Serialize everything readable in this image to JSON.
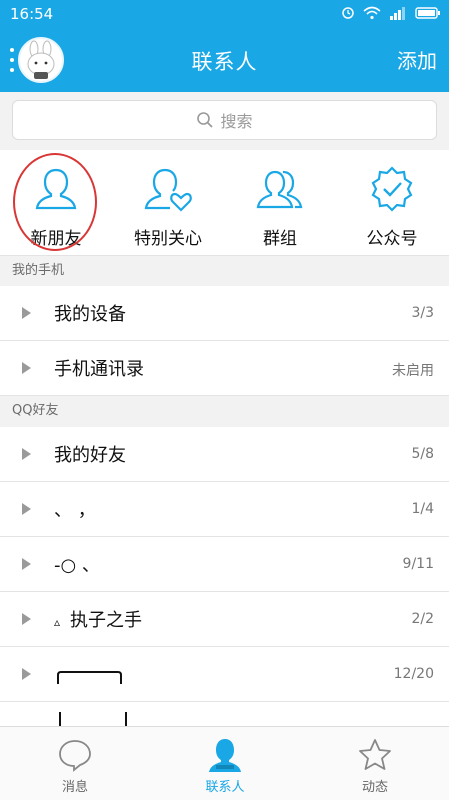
{
  "status_bar": {
    "time": "16:54"
  },
  "header": {
    "title": "联系人",
    "add_label": "添加"
  },
  "search": {
    "placeholder": "搜索"
  },
  "quick_actions": [
    {
      "label": "新朋友",
      "icon": "person-icon"
    },
    {
      "label": "特别关心",
      "icon": "person-heart-icon"
    },
    {
      "label": "群组",
      "icon": "group-icon"
    },
    {
      "label": "公众号",
      "icon": "verified-badge-icon"
    }
  ],
  "sections": {
    "my_phone": {
      "title": "我的手机",
      "rows": [
        {
          "name": "我的设备",
          "count": "3/3"
        },
        {
          "name": "手机通讯录",
          "count": "未启用"
        }
      ]
    },
    "qq_friends": {
      "title": "QQ好友",
      "rows": [
        {
          "name": "我的好友",
          "count": "5/8"
        },
        {
          "name": "、 ，",
          "count": "1/4"
        },
        {
          "name": "-○ 、",
          "count": "9/11"
        },
        {
          "name": "执子之手",
          "prefix": "▵",
          "count": "2/2"
        },
        {
          "name": "",
          "count": "12/20"
        }
      ]
    }
  },
  "bottom_nav": [
    {
      "label": "消息",
      "icon": "chat-bubble-icon",
      "active": false
    },
    {
      "label": "联系人",
      "icon": "contacts-icon",
      "active": true
    },
    {
      "label": "动态",
      "icon": "star-icon",
      "active": false
    }
  ],
  "colors": {
    "primary": "#1aa7e6",
    "highlight_ring": "#d93636"
  }
}
